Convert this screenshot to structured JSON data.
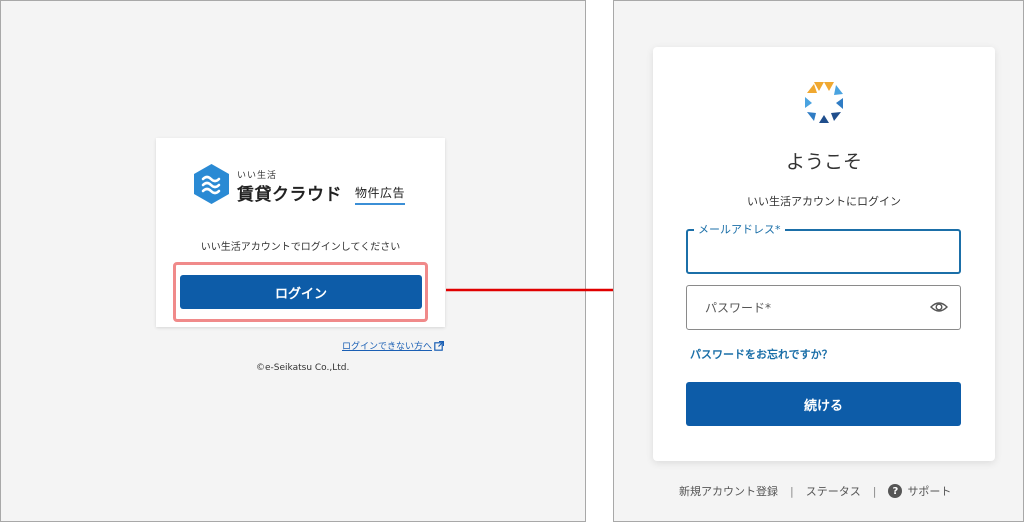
{
  "left": {
    "logo": {
      "small_text": "いい生活",
      "main_text": "賃貸クラウド",
      "sub_text": "物件広告"
    },
    "message": "いい生活アカウントでログインしてください",
    "login_button": "ログイン",
    "help_link": "ログインできない方へ",
    "copyright": "©e-Seikatsu Co.,Ltd."
  },
  "right": {
    "welcome": "ようこそ",
    "subtitle": "いい生活アカウントにログイン",
    "email_label": "メールアドレス*",
    "email_value": "",
    "password_placeholder": "パスワード*",
    "forgot_link": "パスワードをお忘れですか？",
    "continue_button": "続ける",
    "footer": {
      "register": "新規アカウント登録",
      "status": "ステータス",
      "support": "サポート",
      "separator": "|"
    }
  },
  "colors": {
    "primary_button": "#0d5ca8",
    "link": "#1b6fa8",
    "highlight_border": "#f08a8a",
    "arrow": "#e00000",
    "logo_blue": "#2a8ad4"
  },
  "icons": [
    "hexagon-logo-icon",
    "external-link-icon",
    "brand-ring-icon",
    "eye-icon",
    "question-icon",
    "arrow-right-icon"
  ]
}
